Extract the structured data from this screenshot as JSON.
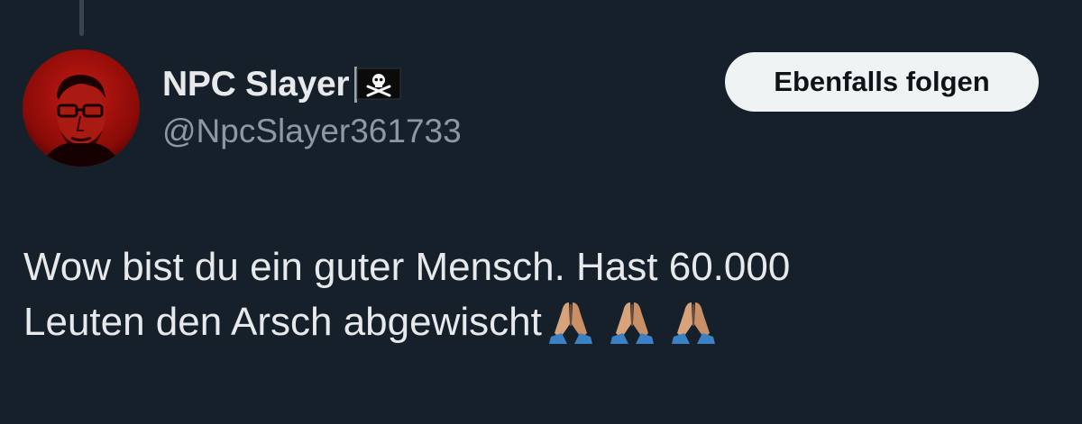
{
  "tweet": {
    "author": {
      "display_name": "NPC Slayer",
      "name_badge_icon": "pirate-flag-icon",
      "handle": "@NpcSlayer361733"
    },
    "follow_button_label": "Ebenfalls folgen",
    "text_line_1": "Wow bist du ein guter Mensch. Hast 60.000",
    "text_line_2": "Leuten den Arsch abgewischt",
    "trailing_emojis": [
      "folded-hands-icon",
      "folded-hands-icon",
      "folded-hands-icon"
    ]
  },
  "colors": {
    "background": "#15202b",
    "primary_text": "#e7e9ea",
    "secondary_text": "#8b98a5",
    "button_bg": "#eff3f4",
    "button_text": "#0f1419"
  }
}
